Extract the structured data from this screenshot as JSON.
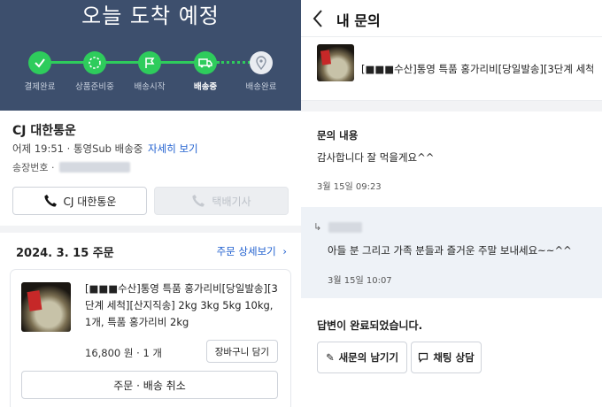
{
  "left": {
    "hero_title": "오늘 도착 예정",
    "steps": [
      {
        "label": "결제완료",
        "icon": "check-icon",
        "done": true
      },
      {
        "label": "상품준비중",
        "icon": "loading-ring-icon",
        "done": true
      },
      {
        "label": "배송시작",
        "icon": "flag-icon",
        "done": true
      },
      {
        "label": "배송중",
        "icon": "truck-icon",
        "done": true,
        "current": true
      },
      {
        "label": "배송완료",
        "icon": "location-pin-icon",
        "done": false
      }
    ],
    "carrier": {
      "name": "CJ 대한통운",
      "status_time": "어제 19:51",
      "status_text": "통영Sub 배송중",
      "detail_link": "자세히 보기",
      "tracking_label": "송장번호 ·",
      "call_carrier_label": "CJ 대한통운",
      "call_driver_label": "택배기사"
    },
    "order": {
      "date": "2024. 3. 15 주문",
      "detail_link": "주문 상세보기",
      "title": "[■■■수산]통영 특품 홍가리비[당일발송][3단계 세척][산지직송] 2kg 3kg 5kg 10kg, 1개, 특품 홍가리비 2kg",
      "price": "16,800 원 · 1 개",
      "cart_button": "장바구니 담기",
      "cancel_button": "주문 · 배송 취소"
    }
  },
  "right": {
    "header_title": "내 문의",
    "product_name": "[■■■수산]통영 특품 홍가리비[당일발송][3단계 세척...",
    "question_label": "문의 내용",
    "question_body": "감사합니다 잘 먹을게요^^",
    "question_date": "3월 15일 09:23",
    "answer_body": "아들 분 그리고 가족 분들과 즐거운 주말 보내세요~~^^",
    "answer_date": "3월 15일 10:07",
    "done_text": "답변이 완료되었습니다.",
    "new_question_button": "새문의 남기기",
    "chat_button": "채팅 상담"
  },
  "colors": {
    "hero_bg": "#3d4f6d",
    "progress_green": "#2ecc5c",
    "link_blue": "#1f5fcf",
    "answer_bg": "#eef2f7"
  }
}
